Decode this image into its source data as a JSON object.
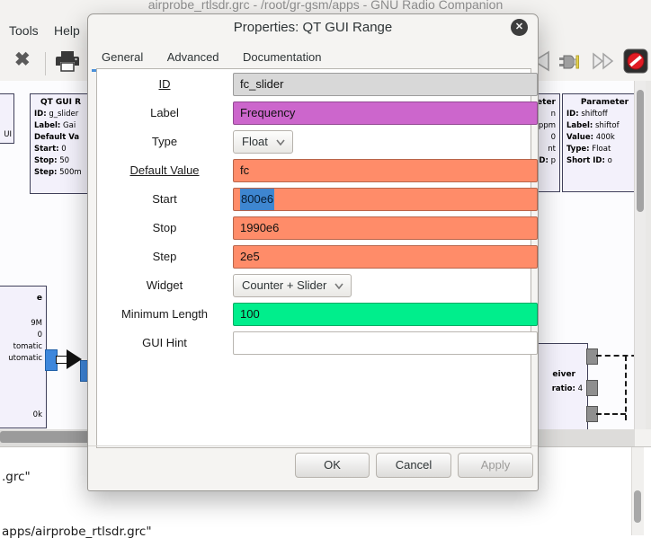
{
  "window": {
    "title": "airprobe_rtlsdr.grc - /root/gr-gsm/apps - GNU Radio Companion"
  },
  "menu": {
    "tools": "Tools",
    "help": "Help"
  },
  "toolbar": {
    "close_glyph": "✖",
    "icons": [
      "close-icon",
      "print-icon",
      "backward-icon",
      "plug-icon",
      "fast-forward-icon",
      "kill-icon"
    ]
  },
  "colors": {
    "accent_blue": "#4A90D9",
    "selection_blue": "#3E86D0",
    "string_magenta": "#CC66CC",
    "float_orange": "#FF8C69",
    "int_green": "#00EE8C",
    "id_gray": "#D8D8D8",
    "port_blue": "#3E87DC",
    "kill_red": "#E01B24"
  },
  "dialog": {
    "title": "Properties: QT GUI Range",
    "close_glyph": "✕",
    "tabs": {
      "general": "General",
      "advanced": "Advanced",
      "documentation": "Documentation"
    },
    "active_tab": "General",
    "rows": [
      {
        "label": "ID",
        "value": "fc_slider",
        "bg": "#D8D8D8"
      },
      {
        "label": "Label",
        "value": "Frequency",
        "bg": "#CC66CC"
      },
      {
        "label": "Type",
        "value": "Float"
      },
      {
        "label": "Default Value",
        "value": "fc",
        "bg": "#FF8C69"
      },
      {
        "label": "Start",
        "value": "800e6",
        "bg": "#FF8C69"
      },
      {
        "label": "Stop",
        "value": "1990e6",
        "bg": "#FF8C69"
      },
      {
        "label": "Step",
        "value": "2e5",
        "bg": "#FF8C69"
      },
      {
        "label": "Widget",
        "value": "Counter + Slider"
      },
      {
        "label": "Minimum Length",
        "value": "100",
        "bg": "#00EE8C"
      },
      {
        "label": "GUI Hint",
        "value": "",
        "bg": "#FFFFFF"
      }
    ],
    "buttons": {
      "ok": "OK",
      "cancel": "Cancel",
      "apply": "Apply"
    }
  },
  "canvas": {
    "blocks": {
      "options_fragment": {
        "label": "UI"
      },
      "qt_gui_range": {
        "title": "QT GUI R",
        "lines": [
          {
            "k": "ID:",
            "v": "g_slider"
          },
          {
            "k": "Label:",
            "v": "Gai"
          },
          {
            "k": "Default Va",
            "v": ""
          },
          {
            "k": "Start:",
            "v": "0"
          },
          {
            "k": "Stop:",
            "v": "50"
          },
          {
            "k": "Step:",
            "v": "500m"
          }
        ]
      },
      "source_fragment": {
        "lines": [
          "e",
          "9M",
          "0",
          "tomatic",
          "utomatic",
          "0k"
        ]
      },
      "param_fragment": {
        "title": "neter",
        "lines": [
          {
            "k": "",
            "v": "n"
          },
          {
            "k": "",
            "v": "ppm"
          },
          {
            "k": "",
            "v": "0"
          },
          {
            "k": "",
            "v": "nt"
          },
          {
            "k": "ID:",
            "v": "p"
          }
        ]
      },
      "parameter": {
        "title": "Parameter",
        "lines": [
          {
            "k": "ID:",
            "v": "shiftoff"
          },
          {
            "k": "Label:",
            "v": "shiftof"
          },
          {
            "k": "Value:",
            "v": "400k"
          },
          {
            "k": "Type:",
            "v": "Float"
          },
          {
            "k": "Short ID:",
            "v": "o"
          }
        ]
      },
      "receiver_fragment": {
        "title": "eiver",
        "lines": [
          {
            "k": "ratio:",
            "v": "4"
          }
        ]
      }
    }
  },
  "console": {
    "line1": ".grc\"",
    "line2": "apps/airprobe_rtlsdr.grc\""
  }
}
